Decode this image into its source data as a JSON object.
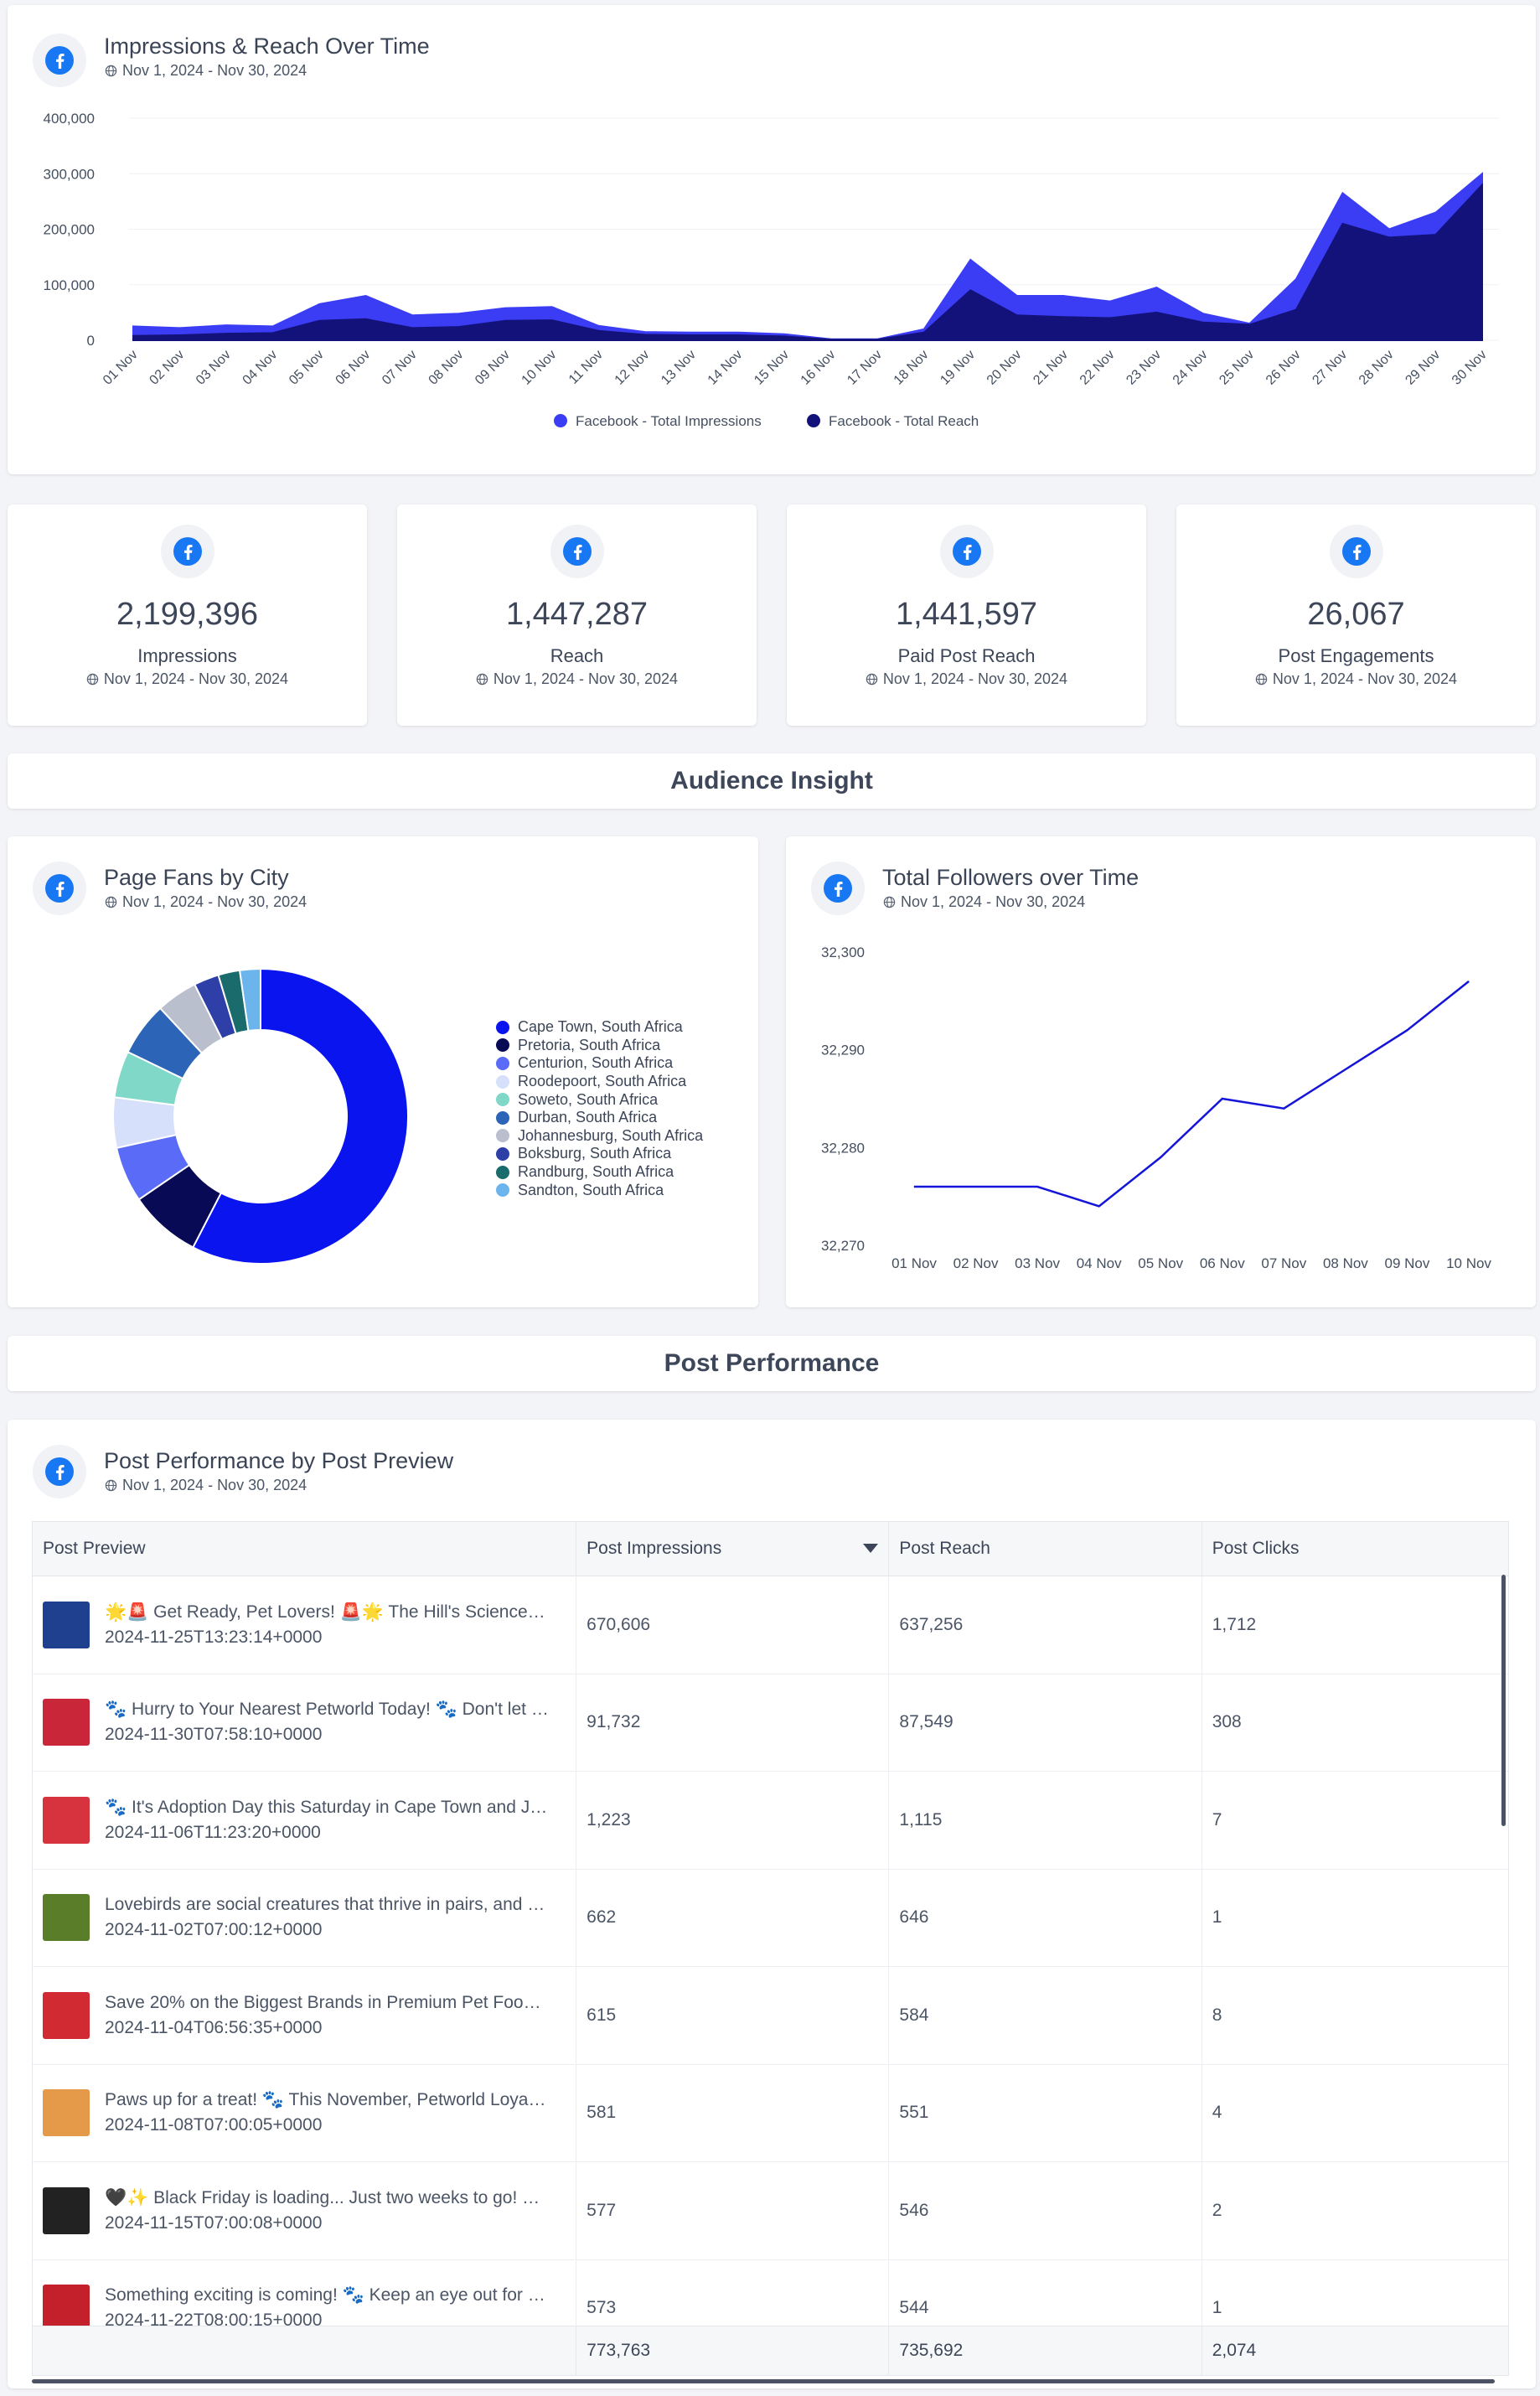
{
  "impressions_card": {
    "title": "Impressions & Reach Over Time",
    "date_range": "Nov 1, 2024 - Nov 30, 2024",
    "y_ticks": [
      "400,000",
      "300,000",
      "200,000",
      "100,000",
      "0"
    ],
    "legend": [
      "Facebook - Total Impressions",
      "Facebook - Total Reach"
    ]
  },
  "kpis": [
    {
      "value": "2,199,396",
      "label": "Impressions",
      "date_range": "Nov 1, 2024 - Nov 30, 2024"
    },
    {
      "value": "1,447,287",
      "label": "Reach",
      "date_range": "Nov 1, 2024 - Nov 30, 2024"
    },
    {
      "value": "1,441,597",
      "label": "Paid Post Reach",
      "date_range": "Nov 1, 2024 - Nov 30, 2024"
    },
    {
      "value": "26,067",
      "label": "Post Engagements",
      "date_range": "Nov 1, 2024 - Nov 30, 2024"
    }
  ],
  "sections": {
    "audience": "Audience Insight",
    "performance": "Post Performance"
  },
  "fans_card": {
    "title": "Page Fans by City",
    "date_range": "Nov 1, 2024 - Nov 30, 2024"
  },
  "followers_card": {
    "title": "Total Followers over Time",
    "date_range": "Nov 1, 2024 - Nov 30, 2024",
    "y_ticks": [
      "32,300",
      "32,290",
      "32,280",
      "32,270"
    ]
  },
  "posts_card": {
    "title": "Post Performance by Post Preview",
    "date_range": "Nov 1, 2024 - Nov 30, 2024",
    "columns": [
      "Post Preview",
      "Post Impressions",
      "Post Reach",
      "Post Clicks"
    ],
    "rows": [
      {
        "title": "🌟🚨 Get Ready, Pet Lovers! 🚨🌟 The Hill's Science Plan Black Friday Sale",
        "date": "2024-11-25T13:23:14+0000",
        "impressions": "670,606",
        "reach": "637,256",
        "clicks": "1,712",
        "thumb_color": "#1f3f8f"
      },
      {
        "title": "🐾 Hurry to Your Nearest Petworld Today! 🐾 Don't let this deal pass you by",
        "date": "2024-11-30T07:58:10+0000",
        "impressions": "91,732",
        "reach": "87,549",
        "clicks": "308",
        "thumb_color": "#c9263a"
      },
      {
        "title": "🐾 It's Adoption Day this Saturday in Cape Town and Johannesburg",
        "date": "2024-11-06T11:23:20+0000",
        "impressions": "1,223",
        "reach": "1,115",
        "clicks": "7",
        "thumb_color": "#d7333f"
      },
      {
        "title": "Lovebirds are social creatures that thrive in pairs, and they love company",
        "date": "2024-11-02T07:00:12+0000",
        "impressions": "662",
        "reach": "646",
        "clicks": "1",
        "thumb_color": "#5a7d2a"
      },
      {
        "title": "Save 20% on the Biggest Brands in Premium Pet Food this November",
        "date": "2024-11-04T06:56:35+0000",
        "impressions": "615",
        "reach": "584",
        "clicks": "8",
        "thumb_color": "#d12a33"
      },
      {
        "title": "Paws up for a treat! 🐾 This November, Petworld Loyalty members get more",
        "date": "2024-11-08T07:00:05+0000",
        "impressions": "581",
        "reach": "551",
        "clicks": "4",
        "thumb_color": "#e59a4a"
      },
      {
        "title": "🖤✨ Black Friday is loading... Just two weeks to go! Get ready for deals",
        "date": "2024-11-15T07:00:08+0000",
        "impressions": "577",
        "reach": "546",
        "clicks": "2",
        "thumb_color": "#222222"
      },
      {
        "title": "Something exciting is coming! 🐾 Keep an eye out for our Red Dot Days",
        "date": "2024-11-22T08:00:15+0000",
        "impressions": "573",
        "reach": "544",
        "clicks": "1",
        "thumb_color": "#c4202b"
      }
    ],
    "totals": {
      "impressions": "773,763",
      "reach": "735,692",
      "clicks": "2,074"
    }
  },
  "chart_data": [
    {
      "type": "area",
      "title": "Impressions & Reach Over Time",
      "categories": [
        "01 Nov",
        "02 Nov",
        "03 Nov",
        "04 Nov",
        "05 Nov",
        "06 Nov",
        "07 Nov",
        "08 Nov",
        "09 Nov",
        "10 Nov",
        "11 Nov",
        "12 Nov",
        "13 Nov",
        "14 Nov",
        "15 Nov",
        "16 Nov",
        "17 Nov",
        "18 Nov",
        "19 Nov",
        "20 Nov",
        "21 Nov",
        "22 Nov",
        "23 Nov",
        "24 Nov",
        "25 Nov",
        "26 Nov",
        "27 Nov",
        "28 Nov",
        "29 Nov",
        "30 Nov"
      ],
      "series": [
        {
          "name": "Facebook - Total Impressions",
          "color": "#3b3df5",
          "values": [
            25000,
            22000,
            27000,
            25000,
            65000,
            80000,
            45000,
            48000,
            58000,
            60000,
            26000,
            15000,
            14000,
            14000,
            11000,
            2000,
            2000,
            20000,
            145000,
            80000,
            80000,
            70000,
            95000,
            48000,
            30000,
            110000,
            265000,
            200000,
            230000,
            300000
          ]
        },
        {
          "name": "Facebook - Total Reach",
          "color": "#13127a",
          "values": [
            8000,
            9000,
            12000,
            13000,
            35000,
            38000,
            22000,
            24000,
            35000,
            36000,
            17000,
            10000,
            9000,
            9000,
            7000,
            1000,
            1000,
            14000,
            90000,
            45000,
            42000,
            40000,
            50000,
            32000,
            28000,
            55000,
            210000,
            185000,
            190000,
            280000
          ]
        }
      ],
      "ylim": [
        0,
        400000
      ],
      "legend": "bottom"
    },
    {
      "type": "pie",
      "title": "Page Fans by City",
      "legend": "right",
      "slices": [
        {
          "label": "Cape Town, South Africa",
          "value": 58.5,
          "color": "#0a14ef"
        },
        {
          "label": "Pretoria, South Africa",
          "value": 8.0,
          "color": "#080a55"
        },
        {
          "label": "Centurion, South Africa",
          "value": 6.2,
          "color": "#5a6bf7"
        },
        {
          "label": "Roodepoort, South Africa",
          "value": 5.6,
          "color": "#d6e0fb"
        },
        {
          "label": "Soweto, South Africa",
          "value": 5.2,
          "color": "#7fd8c8"
        },
        {
          "label": "Durban, South Africa",
          "value": 6.0,
          "color": "#2c64b8"
        },
        {
          "label": "Johannesburg, South Africa",
          "value": 4.6,
          "color": "#b9bfcc"
        },
        {
          "label": "Boksburg, South Africa",
          "value": 2.8,
          "color": "#2f3fa8"
        },
        {
          "label": "Randburg, South Africa",
          "value": 2.4,
          "color": "#1a6b6b"
        },
        {
          "label": "Sandton, South Africa",
          "value": 2.3,
          "color": "#6cb4ec"
        }
      ]
    },
    {
      "type": "line",
      "title": "Total Followers over Time",
      "categories": [
        "01 Nov",
        "02 Nov",
        "03 Nov",
        "04 Nov",
        "05 Nov",
        "06 Nov",
        "07 Nov",
        "08 Nov",
        "09 Nov",
        "10 Nov"
      ],
      "series": [
        {
          "name": "Total Followers",
          "color": "#1515d9",
          "values": [
            32276,
            32276,
            32276,
            32274,
            32279,
            32285,
            32284,
            32288,
            32292,
            32297
          ]
        }
      ],
      "ylim": [
        32270,
        32300
      ]
    }
  ]
}
